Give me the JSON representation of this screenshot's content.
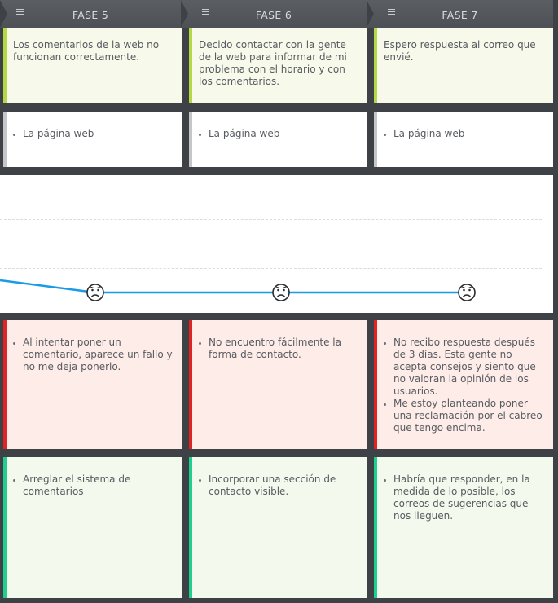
{
  "phases": [
    {
      "title": "FASE 5",
      "description": "Los comentarios de la web no funcionan correctamente.",
      "channels": [
        "La página web"
      ],
      "pains": [
        "Al intentar poner un comentario, aparece un fallo y no me deja ponerlo."
      ],
      "opportunities": [
        "Arreglar el sistema de comentarios"
      ]
    },
    {
      "title": "FASE 6",
      "description": "Decido contactar con la gente de la web para informar de mi problema con el horario y con los comentarios.",
      "channels": [
        "La página web"
      ],
      "pains": [
        "No encuentro fácilmente la forma de contacto."
      ],
      "opportunities": [
        "Incorporar una sección de contacto visible."
      ]
    },
    {
      "title": "FASE 7",
      "description": "Espero respuesta al correo que envié.",
      "channels": [
        "La página web"
      ],
      "pains": [
        "No recibo respuesta después de 3 días. Esta gente no acepta consejos y siento que no valoran la opinión de los usuarios.",
        "Me estoy planteando poner una reclamación por el cabreo que tengo encima."
      ],
      "opportunities": [
        "Habría que responder, en la medida de lo posible, los correos de sugerencias que nos lleguen."
      ]
    }
  ],
  "emotion_curve": {
    "points": [
      "sad",
      "sad",
      "sad"
    ],
    "line_color": "#1a9be6"
  },
  "icons": {
    "header_menu": "menu-icon",
    "emotion": "sad-face-icon"
  },
  "colors": {
    "description_bar": "#b3d947",
    "channel_bar": "#c4c6c8",
    "pain_bar": "#e02424",
    "opportunity_bar": "#1fcf8e",
    "header_bg": "#55595e"
  }
}
